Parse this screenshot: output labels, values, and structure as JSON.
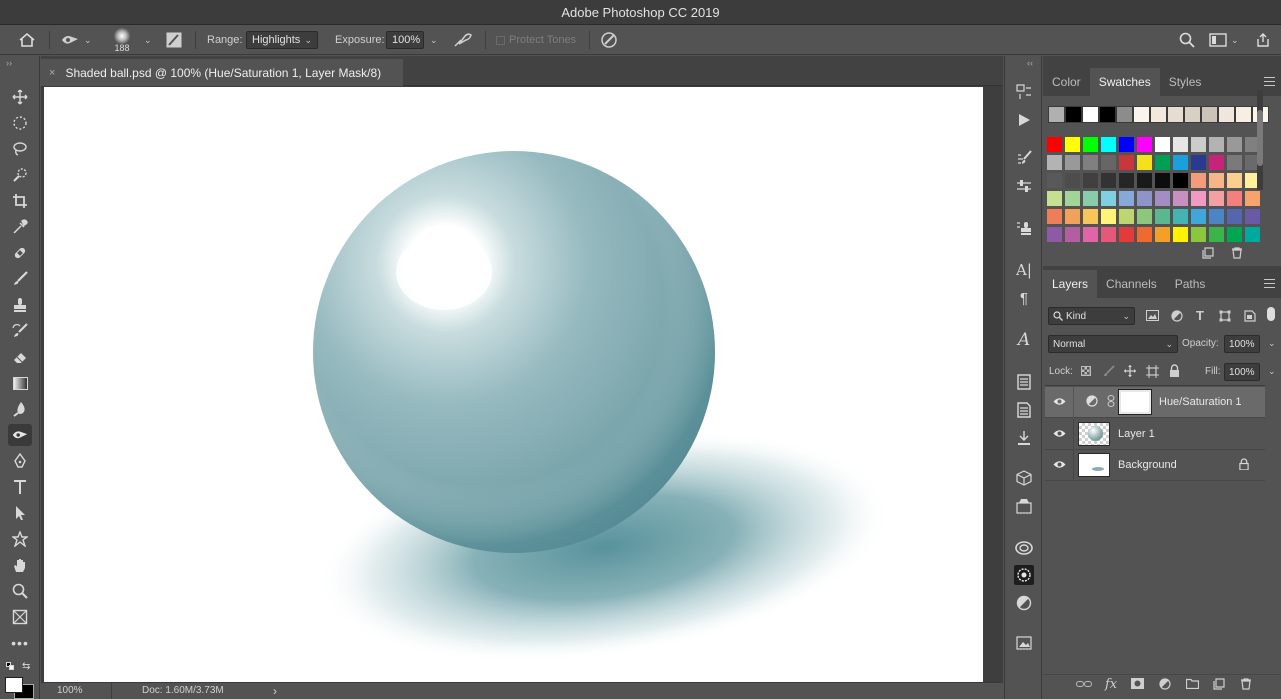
{
  "app": {
    "title": "Adobe Photoshop CC 2019"
  },
  "options": {
    "brush_size": "188",
    "range_label": "Range:",
    "range_value": "Highlights",
    "exposure_label": "Exposure:",
    "exposure_value": "100%",
    "protect_tones": "Protect Tones"
  },
  "document": {
    "tab_title": "Shaded ball.psd @ 100% (Hue/Saturation 1, Layer Mask/8)",
    "close_glyph": "×"
  },
  "status": {
    "zoom": "100%",
    "doc": "Doc: 1.60M/3.73M",
    "arrow": "›"
  },
  "swatch_panel": {
    "tabs": [
      "Color",
      "Swatches",
      "Styles"
    ],
    "active_tab": "Swatches",
    "recent": [
      "#b0b0b0",
      "#000000",
      "#ffffff",
      "#000000",
      "#8c8c8c",
      "#fbf4ec",
      "#f3e8dc",
      "#e6dccf",
      "#d9d0c4",
      "#ccc3b8",
      "#efe7dd",
      "#f7efe4",
      "#fbf5ec"
    ],
    "grid": [
      [
        "#ff0000",
        "#ffff00",
        "#00ff00",
        "#00ffff",
        "#0000ff",
        "#ff00ff",
        "#ffffff",
        "#e6e6e6",
        "#cccccc",
        "#b3b3b3",
        "#999999",
        "#808080"
      ],
      [
        "#b3b3b3",
        "#999999",
        "#808080",
        "#666666",
        "#c8373c",
        "#f4e01f",
        "#00a054",
        "#1aa0dc",
        "#2b3990",
        "#c8237a",
        "#7a7a7a",
        "#6a6a6a"
      ],
      [
        "#595959",
        "#4d4d4d",
        "#404040",
        "#333333",
        "#262626",
        "#1a1a1a",
        "#0d0d0d",
        "#000000",
        "#f29c7c",
        "#f7b58a",
        "#fbd08f",
        "#fff09b"
      ],
      [
        "#c6df93",
        "#a3d497",
        "#88ccac",
        "#7fd1e2",
        "#86a9d8",
        "#8e93c8",
        "#a48dc2",
        "#c890c0",
        "#f19ac4",
        "#f3a0a2",
        "#f57e7e",
        "#f6a36e"
      ],
      [
        "#ee7e58",
        "#f1a15a",
        "#f7c65a",
        "#fff37a",
        "#bed66f",
        "#8dc77c",
        "#5bb88e",
        "#43b4b0",
        "#3fa7d9",
        "#4c85c6",
        "#5466ad",
        "#6a5aa6"
      ],
      [
        "#8e5aa5",
        "#b45da3",
        "#e064a6",
        "#e5587a",
        "#e23b3b",
        "#ef6a30",
        "#f59f2b",
        "#fff200",
        "#8cc63f",
        "#39b54a",
        "#00a651",
        "#00a99d"
      ]
    ]
  },
  "layers_panel": {
    "tabs": [
      "Layers",
      "Channels",
      "Paths"
    ],
    "active_tab": "Layers",
    "filter": "Kind",
    "blend_mode": "Normal",
    "opacity_label": "Opacity:",
    "opacity": "100%",
    "lock_label": "Lock:",
    "fill_label": "Fill:",
    "fill": "100%",
    "layers": [
      {
        "name": "Hue/Saturation 1",
        "selected": true
      },
      {
        "name": "Layer 1",
        "selected": false
      },
      {
        "name": "Background",
        "selected": false
      }
    ]
  },
  "colors": {
    "teal_ball": "#7ea8ae",
    "shadow": "#4f8c96",
    "ui_bg": "#535353",
    "ui_dark": "#424242"
  }
}
